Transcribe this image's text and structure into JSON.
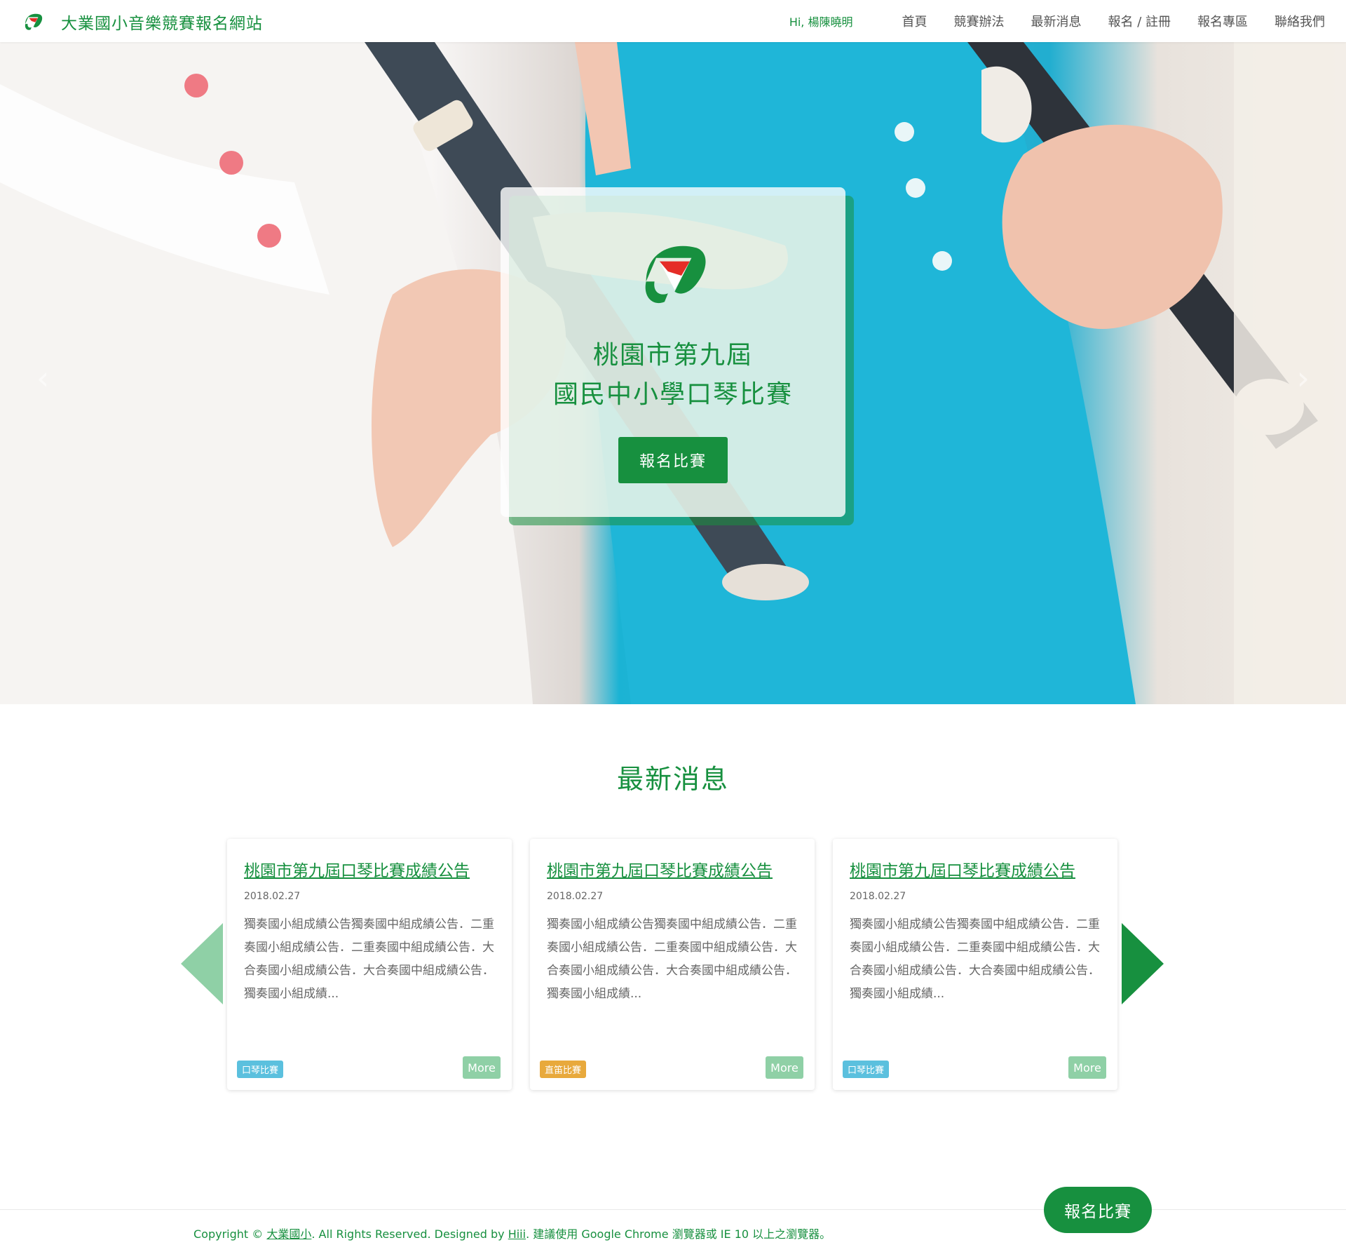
{
  "header": {
    "brand_title": "大業國小音樂競賽報名網站",
    "greeting": "Hi, 楊陳曉明",
    "nav": [
      "首頁",
      "競賽辦法",
      "最新消息",
      "報名 / 註冊",
      "報名專區",
      "聯絡我們"
    ]
  },
  "hero": {
    "title_line1": "桃園市第九屆",
    "title_line2": "國民中小學口琴比賽",
    "cta_label": "報名比賽",
    "prev_glyph": "‹",
    "next_glyph": "›"
  },
  "news": {
    "section_title": "最新消息",
    "items": [
      {
        "title": "桃園市第九屆口琴比賽成績公告",
        "date": "2018.02.27",
        "excerpt": "獨奏國小組成績公告獨奏國中組成績公告．二重奏國小組成績公告．二重奏國中組成績公告．大合奏國小組成績公告．大合奏國中組成績公告．獨奏國小組成績...",
        "tag": "口琴比賽",
        "more": "More"
      },
      {
        "title": "桃園市第九屆口琴比賽成績公告",
        "date": "2018.02.27",
        "excerpt": "獨奏國小組成績公告獨奏國中組成績公告．二重奏國小組成績公告．二重奏國中組成績公告．大合奏國小組成績公告．大合奏國中組成績公告．獨奏國小組成績...",
        "tag": "直笛比賽",
        "more": "More"
      },
      {
        "title": "桃園市第九屆口琴比賽成績公告",
        "date": "2018.02.27",
        "excerpt": "獨奏國小組成績公告獨奏國中組成績公告．二重奏國小組成績公告．二重奏國中組成績公告．大合奏國小組成績公告．大合奏國中組成績公告．獨奏國小組成績...",
        "tag": "口琴比賽",
        "more": "More"
      }
    ]
  },
  "footer": {
    "copyright_prefix": "Copyright © ",
    "school_link": "大業國小",
    "middle": ". All Rights Reserved. Designed by ",
    "designer_link": "Hiii",
    "suffix": ". 建議使用 Google Chrome 瀏覽器或 IE 10 以上之瀏覽器。"
  },
  "floating_cta": "報名比賽",
  "colors": {
    "brand_green": "#17903f",
    "brand_red": "#e52d27",
    "light_green": "#8fd0a6",
    "tag_blue": "#5bc0de",
    "tag_orange": "#e8a93c"
  }
}
